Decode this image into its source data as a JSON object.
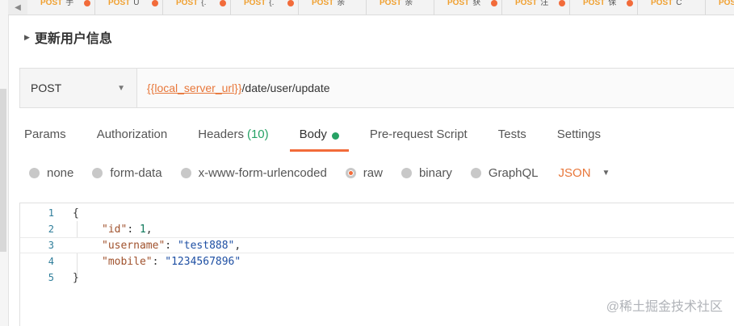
{
  "tabs": [
    {
      "method": "POST",
      "name": "手"
    },
    {
      "method": "POST",
      "name": "U"
    },
    {
      "method": "POST",
      "name": "{."
    },
    {
      "method": "POST",
      "name": "{."
    },
    {
      "method": "POST",
      "name": "亲"
    },
    {
      "method": "POST",
      "name": "亲"
    },
    {
      "method": "POST",
      "name": "获"
    },
    {
      "method": "POST",
      "name": "注"
    },
    {
      "method": "POST",
      "name": "保"
    },
    {
      "method": "POST",
      "name": "C"
    },
    {
      "method": "POS",
      "name": ""
    }
  ],
  "request": {
    "title": "更新用户信息",
    "method": "POST",
    "url_variable": "{{local_server_url}}",
    "url_path": "/date/user/update"
  },
  "request_tabs": [
    {
      "label": "Params",
      "count": ""
    },
    {
      "label": "Authorization",
      "count": ""
    },
    {
      "label": "Headers",
      "count": "(10)"
    },
    {
      "label": "Body",
      "count": ""
    },
    {
      "label": "Pre-request Script",
      "count": ""
    },
    {
      "label": "Tests",
      "count": ""
    },
    {
      "label": "Settings",
      "count": ""
    }
  ],
  "body_types": [
    "none",
    "form-data",
    "x-www-form-urlencoded",
    "raw",
    "binary",
    "GraphQL"
  ],
  "body_format": "JSON",
  "editor": {
    "line_numbers": [
      "1",
      "2",
      "3",
      "4",
      "5"
    ],
    "open_brace": "{",
    "close_brace": "}",
    "fields": [
      {
        "key": "\"id\"",
        "value": "1",
        "suffix": ","
      },
      {
        "key": "\"username\"",
        "value": "\"test888\"",
        "suffix": ","
      },
      {
        "key": "\"mobile\"",
        "value": "\"1234567896\"",
        "suffix": ""
      }
    ]
  },
  "watermark": "@稀土掘金技术社区",
  "colors": {
    "accent": "#f26b3a",
    "success": "#26a265",
    "variable": "#e8773a"
  }
}
